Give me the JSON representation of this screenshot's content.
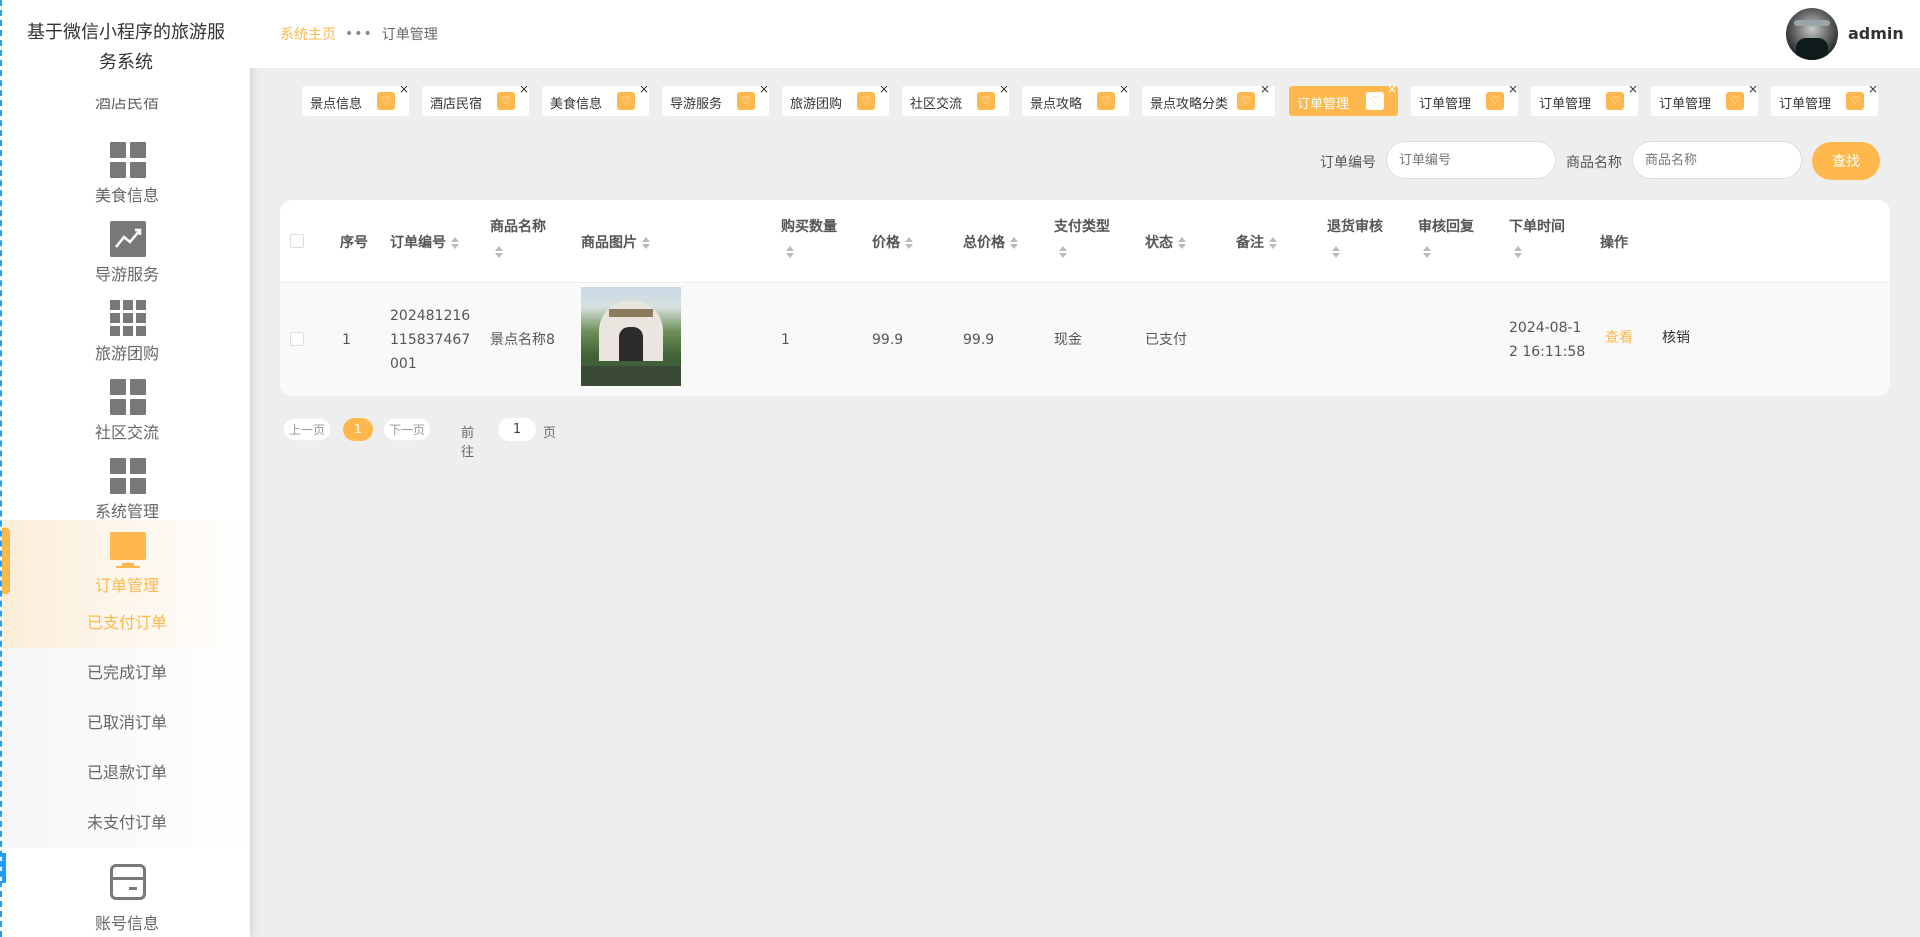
{
  "app": {
    "title": "基于微信小程序的旅游服务系统"
  },
  "sidebar": {
    "cut_item": "酒店民宿",
    "items": [
      {
        "label": "美食信息",
        "icon": "grid-icon"
      },
      {
        "label": "导游服务",
        "icon": "chart-icon"
      },
      {
        "label": "旅游团购",
        "icon": "apps-icon"
      },
      {
        "label": "社区交流",
        "icon": "grid-icon"
      },
      {
        "label": "系统管理",
        "icon": "grid-icon"
      },
      {
        "label": "订单管理",
        "icon": "monitor-icon",
        "active": true
      },
      {
        "label": "账号信息",
        "icon": "wallet-icon"
      }
    ],
    "sub_items": [
      {
        "label": "已支付订单",
        "active": true
      },
      {
        "label": "已完成订单"
      },
      {
        "label": "已取消订单"
      },
      {
        "label": "已退款订单"
      },
      {
        "label": "未支付订单"
      }
    ]
  },
  "header": {
    "breadcrumb_home": "系统主页",
    "breadcrumb_sep": "•••",
    "breadcrumb_current": "订单管理",
    "username": "admin"
  },
  "tabs": [
    {
      "label": "景点信息"
    },
    {
      "label": "酒店民宿"
    },
    {
      "label": "美食信息"
    },
    {
      "label": "导游服务"
    },
    {
      "label": "旅游团购"
    },
    {
      "label": "社区交流"
    },
    {
      "label": "景点攻略"
    },
    {
      "label": "景点攻略分类"
    },
    {
      "label": "订单管理",
      "active": true
    },
    {
      "label": "订单管理"
    },
    {
      "label": "订单管理"
    },
    {
      "label": "订单管理"
    },
    {
      "label": "订单管理"
    }
  ],
  "search": {
    "order_no_label": "订单编号",
    "order_no_placeholder": "订单编号",
    "goods_name_label": "商品名称",
    "goods_name_placeholder": "商品名称",
    "button": "查找"
  },
  "table": {
    "columns": [
      "序号",
      "订单编号",
      "商品名称",
      "商品图片",
      "购买数量",
      "价格",
      "总价格",
      "支付类型",
      "状态",
      "备注",
      "退货审核",
      "审核回复",
      "下单时间",
      "操作"
    ],
    "rows": [
      {
        "index": "1",
        "order_no": [
          "202481216",
          "115837467",
          "001"
        ],
        "goods_name": "景点名称8",
        "quantity": "1",
        "price": "99.9",
        "total": "99.9",
        "pay_type": "现金",
        "status": "已支付",
        "remark": "",
        "return_review": "",
        "review_reply": "",
        "order_time": [
          "2024-08-1",
          "2 16:11:58"
        ],
        "action_view": "查看",
        "action_verify": "核销"
      }
    ]
  },
  "pagination": {
    "prev": "上一页",
    "current": "1",
    "next": "下一页",
    "goto_label": "前往",
    "goto_value": "1",
    "page_suffix": "页"
  },
  "colors": {
    "accent": "#ffb84d",
    "sidebar_marker": "#1e9fff"
  }
}
